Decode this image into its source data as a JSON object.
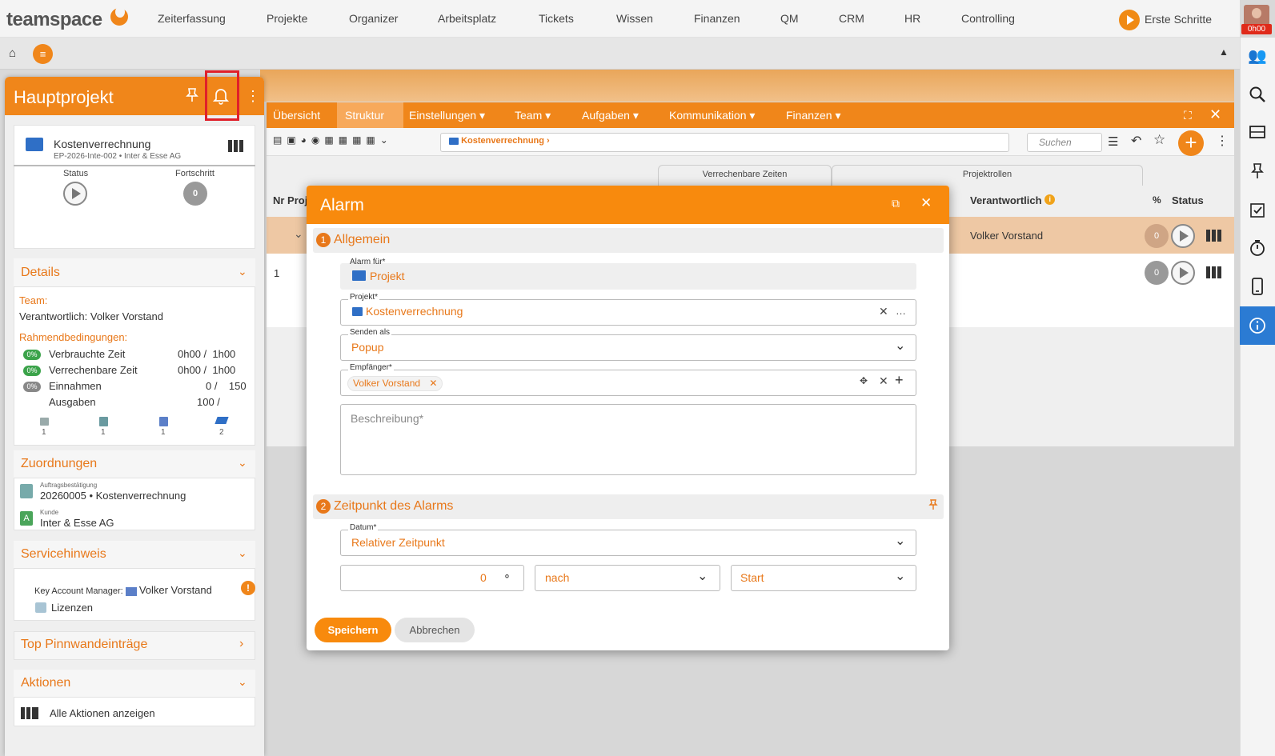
{
  "app": {
    "logo": "teamspace"
  },
  "nav": [
    "Zeiterfassung",
    "Projekte",
    "Organizer",
    "Arbeitsplatz",
    "Tickets",
    "Wissen",
    "Finanzen",
    "QM",
    "CRM",
    "HR",
    "Controlling"
  ],
  "onboarding": {
    "label": "Erste Schritte"
  },
  "user": {
    "timer": "0h00"
  },
  "left_panel": {
    "title": "Hauptprojekt",
    "project": {
      "name": "Kostenverrechnung",
      "subtitle": "EP-2026-Inte-002 • Inter & Esse AG",
      "status_label": "Status",
      "progress_label": "Fortschritt",
      "progress_value": "0"
    },
    "details": {
      "title": "Details",
      "team_label": "Team:",
      "responsible": "Verantwortlich: Volker Vorstand",
      "conditions_label": "Rahmendbedingungen:",
      "rows": [
        {
          "badge": "0%",
          "label": "Verbrauchte Zeit",
          "value": "0h00 /  1h00"
        },
        {
          "badge": "0%",
          "label": "Verrechenbare Zeit",
          "value": "0h00 /  1h00"
        },
        {
          "badge": "0%",
          "label": "Einnahmen",
          "value": "0 /    150"
        },
        {
          "badge": "",
          "label": "Ausgaben",
          "value": "100 /"
        }
      ],
      "counters": [
        "1",
        "1",
        "1",
        "2"
      ]
    },
    "zuordnungen": {
      "title": "Zuordnungen",
      "items": [
        {
          "caption": "Auftragsbestätigung",
          "value": "20260005 • Kostenverrechnung"
        },
        {
          "caption": "Kunde",
          "value": "Inter & Esse AG"
        }
      ]
    },
    "servicehinweis": {
      "title": "Servicehinweis",
      "kam_label": "Key Account Manager:",
      "kam_value": "Volker Vorstand",
      "licenses": "Lizenzen"
    },
    "pinnwand": {
      "title": "Top Pinnwandeinträge"
    },
    "aktionen": {
      "title": "Aktionen",
      "all": "Alle Aktionen anzeigen"
    }
  },
  "project_window": {
    "tabs": [
      "Übersicht",
      "Struktur",
      "Einstellungen ▾",
      "Team ▾",
      "Aufgaben ▾",
      "Kommunikation ▾",
      "Finanzen ▾"
    ],
    "breadcrumb": "Kostenverrechnung",
    "search_placeholder": "Suchen",
    "group_headers": [
      "Verrechenbare Zeiten",
      "Projektrollen"
    ],
    "columns": {
      "nr": "Nr Proj",
      "responsible": "Verantwortlich",
      "pct": "%",
      "status": "Status"
    },
    "rows": [
      {
        "nr": "",
        "responsible": "Volker Vorstand",
        "pct": "0"
      },
      {
        "nr": "1",
        "responsible": "",
        "pct": "0"
      }
    ]
  },
  "modal": {
    "title": "Alarm",
    "section1": {
      "num": "1",
      "title": "Allgemein"
    },
    "alarm_for": {
      "label": "Alarm für*",
      "value": "Projekt"
    },
    "project": {
      "label": "Projekt*",
      "value": "Kostenverrechnung"
    },
    "send_as": {
      "label": "Senden als",
      "value": "Popup"
    },
    "recipient": {
      "label": "Empfänger*",
      "chip": "Volker Vorstand"
    },
    "description": {
      "placeholder": "Beschreibung*"
    },
    "section2": {
      "num": "2",
      "title": "Zeitpunkt des Alarms"
    },
    "date": {
      "label": "Datum*",
      "value": "Relativer Zeitpunkt"
    },
    "offset": {
      "value": "0"
    },
    "relation": {
      "value": "nach"
    },
    "anchor": {
      "value": "Start"
    },
    "save": "Speichern",
    "cancel": "Abbrechen"
  },
  "colors": {
    "accent": "#f88a0d",
    "highlight": "#e0202a",
    "info": "#2b7bd3"
  }
}
